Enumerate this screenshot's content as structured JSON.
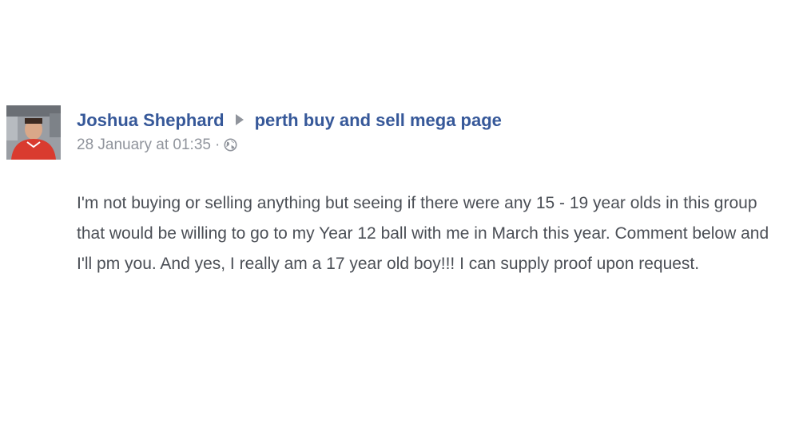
{
  "post": {
    "author": "Joshua Shephard",
    "group": "perth buy and sell mega page",
    "timestamp": "28 January at 01:35",
    "separator": "·",
    "privacy_icon": "globe-icon",
    "message": "I'm not buying or selling anything but seeing if there were any 15 - 19 year olds in this group that would be willing to go to my Year 12 ball with me in March this year. Comment below and I'll pm you. And yes, I really am a 17 year old boy!!! I can supply proof upon request."
  },
  "colors": {
    "link": "#365899",
    "meta": "#90949c",
    "text": "#4b4f56"
  }
}
